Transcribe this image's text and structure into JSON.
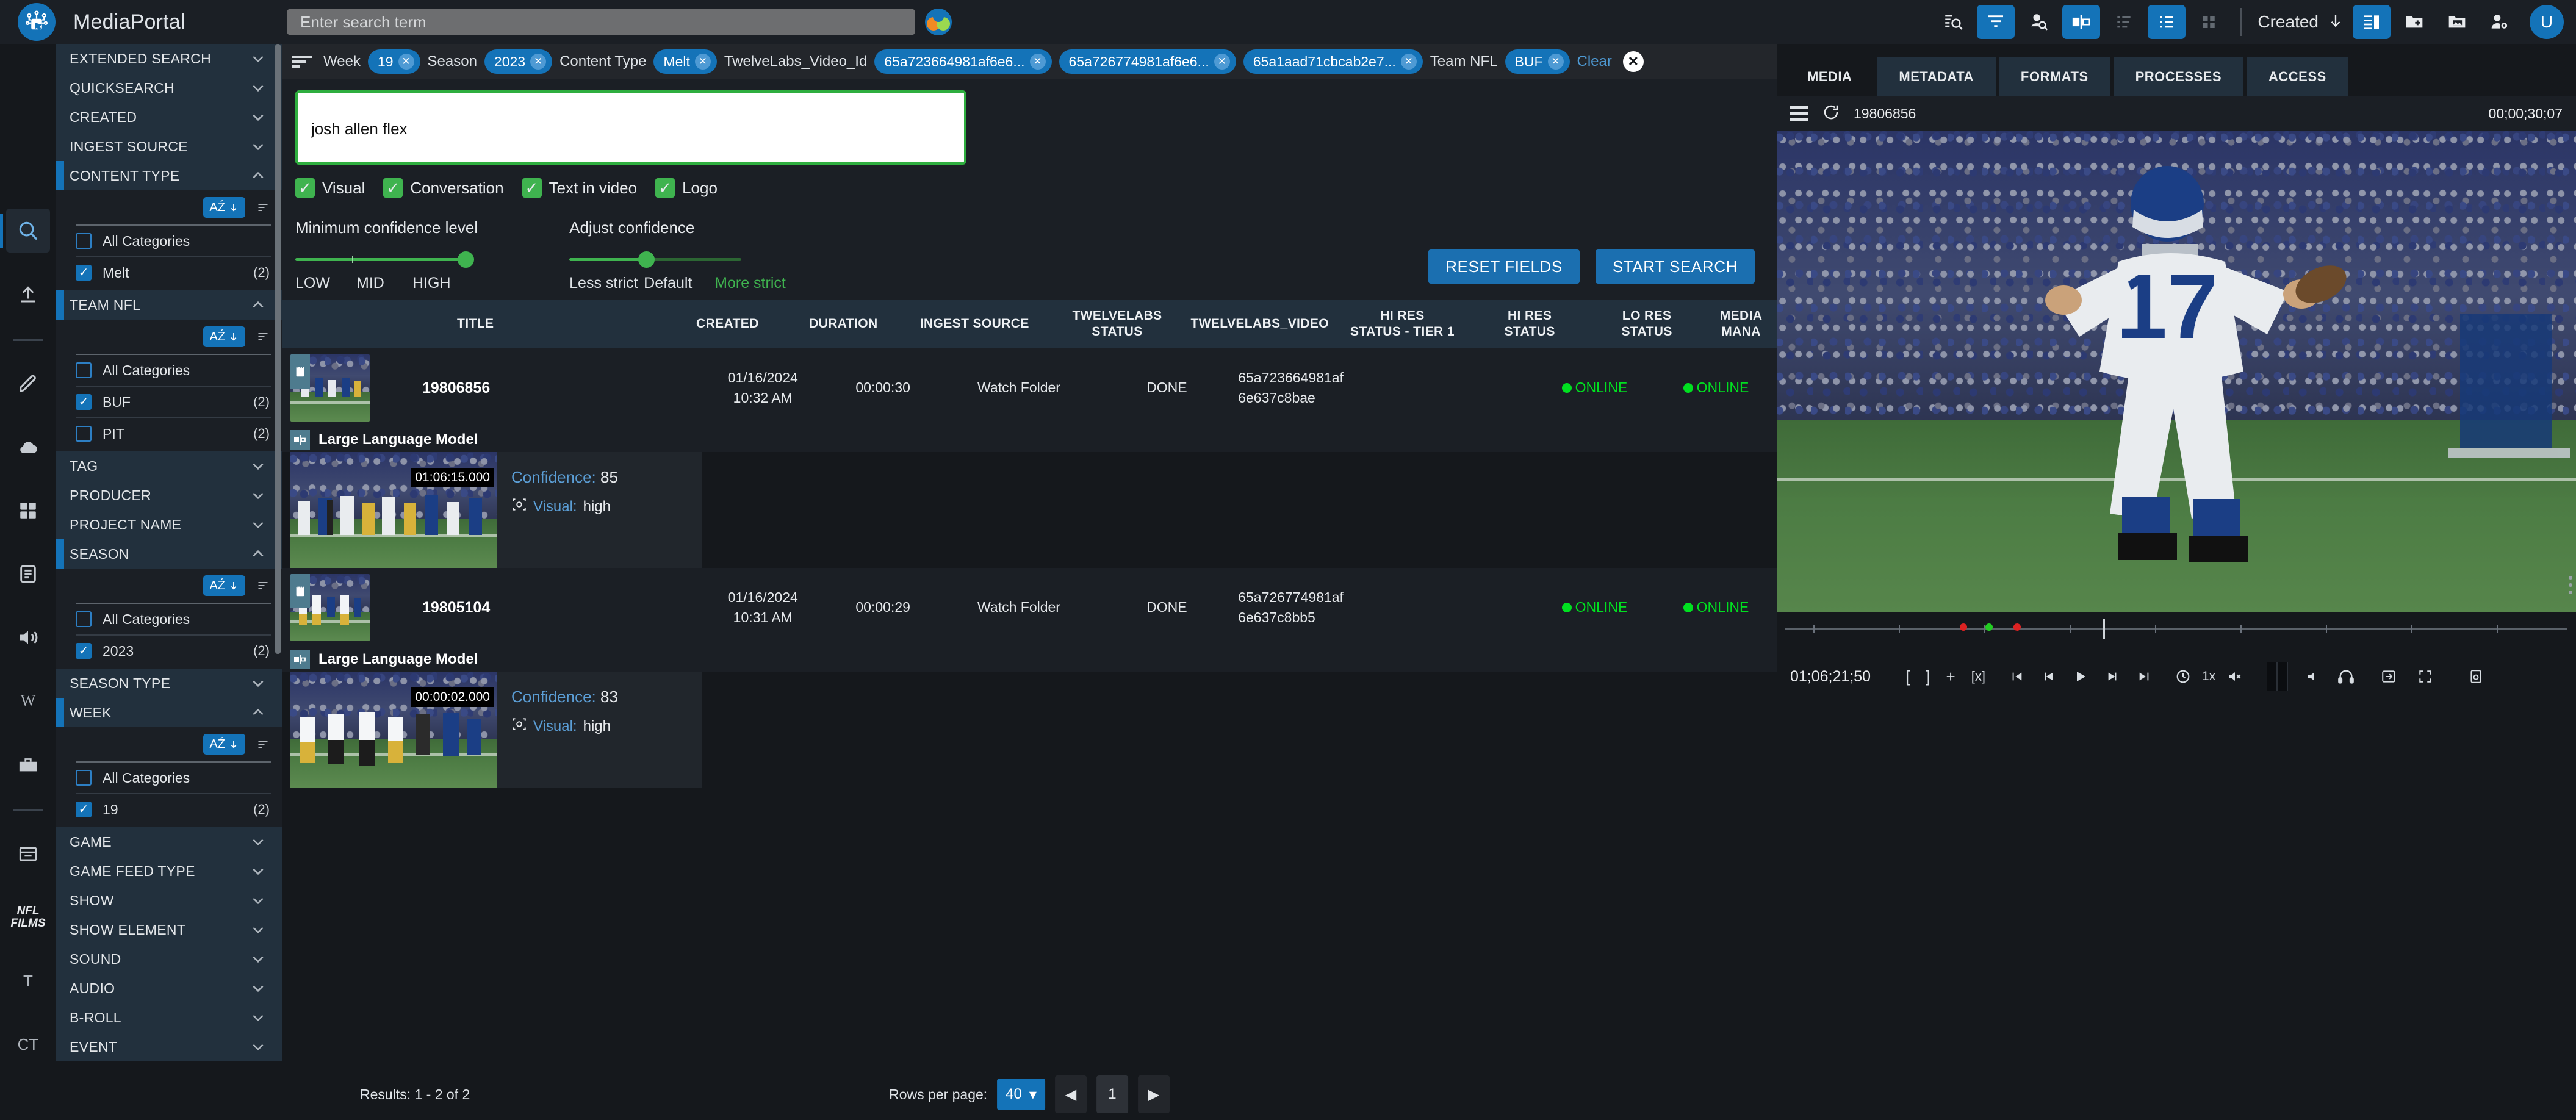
{
  "app": {
    "brand": "MediaPortal",
    "logo_icon": "media-portal-logo-icon",
    "accent_blue": "#1473b8",
    "accent_green": "#3fb34f",
    "status_green": "#00e020"
  },
  "topbar": {
    "search_placeholder": "Enter search term",
    "sort_label": "Created",
    "avatar_initial": "U",
    "icons": [
      {
        "name": "extended-search-icon",
        "active": false
      },
      {
        "name": "filter-icon",
        "active": true
      },
      {
        "name": "person-search-icon",
        "active": false
      },
      {
        "name": "split-view-icon",
        "active": true
      },
      {
        "name": "list-compact-icon",
        "active": false
      },
      {
        "name": "list-detail-icon",
        "active": true
      },
      {
        "name": "grid-view-icon",
        "active": false
      },
      {
        "name": "sort-descending-icon",
        "active": false
      },
      {
        "name": "side-panel-icon",
        "active": true
      },
      {
        "name": "new-folder-icon",
        "active": false
      },
      {
        "name": "media-folder-icon",
        "active": false
      },
      {
        "name": "user-settings-icon",
        "active": false
      }
    ]
  },
  "rail": {
    "items": [
      {
        "name": "search-icon",
        "selected": true
      },
      {
        "name": "upload-icon",
        "selected": false
      },
      {
        "name": "divider",
        "selected": false
      },
      {
        "name": "edit-pen-icon",
        "selected": false
      },
      {
        "name": "cloud-icon",
        "selected": false
      },
      {
        "name": "dashboard-icon",
        "selected": false
      },
      {
        "name": "tasks-icon",
        "selected": false
      },
      {
        "name": "audio-icon",
        "selected": false
      },
      {
        "name": "wikipedia-icon",
        "selected": false
      },
      {
        "name": "toolbox-icon",
        "selected": false
      },
      {
        "name": "divider",
        "selected": false
      },
      {
        "name": "archive-icon",
        "selected": false
      },
      {
        "name": "nfl-films-logo",
        "selected": false
      },
      {
        "name": "t-icon",
        "selected": false
      },
      {
        "name": "ct-icon",
        "selected": false
      }
    ],
    "nfl_line1": "NFL",
    "nfl_line2": "FILMS",
    "t_label": "T",
    "ct_label": "CT"
  },
  "sidebar": {
    "az_label": "Aẋ",
    "all_categories_label": "All Categories",
    "facets": [
      {
        "title": "EXTENDED SEARCH",
        "open": false,
        "options": []
      },
      {
        "title": "QUICKSEARCH",
        "open": false,
        "options": []
      },
      {
        "title": "CREATED",
        "open": false,
        "options": []
      },
      {
        "title": "INGEST SOURCE",
        "open": false,
        "options": []
      },
      {
        "title": "CONTENT TYPE",
        "open": true,
        "options": [
          {
            "label": "All Categories",
            "checked": false,
            "count": ""
          },
          {
            "label": "Melt",
            "checked": true,
            "count": "(2)"
          }
        ]
      },
      {
        "title": "TEAM NFL",
        "open": true,
        "options": [
          {
            "label": "All Categories",
            "checked": false,
            "count": ""
          },
          {
            "label": "BUF",
            "checked": true,
            "count": "(2)"
          },
          {
            "label": "PIT",
            "checked": false,
            "count": "(2)"
          }
        ]
      },
      {
        "title": "TAG",
        "open": false,
        "options": []
      },
      {
        "title": "PRODUCER",
        "open": false,
        "options": []
      },
      {
        "title": "PROJECT NAME",
        "open": false,
        "options": []
      },
      {
        "title": "SEASON",
        "open": true,
        "options": [
          {
            "label": "All Categories",
            "checked": false,
            "count": ""
          },
          {
            "label": "2023",
            "checked": true,
            "count": "(2)"
          }
        ]
      },
      {
        "title": "SEASON TYPE",
        "open": false,
        "options": []
      },
      {
        "title": "WEEK",
        "open": true,
        "options": [
          {
            "label": "All Categories",
            "checked": false,
            "count": ""
          },
          {
            "label": "19",
            "checked": true,
            "count": "(2)"
          }
        ]
      },
      {
        "title": "GAME",
        "open": false,
        "options": []
      },
      {
        "title": "GAME FEED TYPE",
        "open": false,
        "options": []
      },
      {
        "title": "SHOW",
        "open": false,
        "options": []
      },
      {
        "title": "SHOW ELEMENT",
        "open": false,
        "options": []
      },
      {
        "title": "SOUND",
        "open": false,
        "options": []
      },
      {
        "title": "AUDIO",
        "open": false,
        "options": []
      },
      {
        "title": "B-ROLL",
        "open": false,
        "options": []
      },
      {
        "title": "EVENT",
        "open": false,
        "options": []
      }
    ]
  },
  "filterbar": {
    "clear_label": "Clear",
    "groups": [
      {
        "label": "Week",
        "chips": [
          "19"
        ]
      },
      {
        "label": "Season",
        "chips": [
          "2023"
        ]
      },
      {
        "label": "Content Type",
        "chips": [
          "Melt"
        ]
      },
      {
        "label": "TwelveLabs_Video_Id",
        "chips": [
          "65a723664981af6e6...",
          "65a726774981af6e6...",
          "65a1aad71cbcab2e7..."
        ]
      },
      {
        "label": "Team NFL",
        "chips": [
          "BUF"
        ]
      }
    ]
  },
  "searchpanel": {
    "query": "josh allen flex",
    "modalities": [
      {
        "label": "Visual",
        "checked": true
      },
      {
        "label": "Conversation",
        "checked": true
      },
      {
        "label": "Text in video",
        "checked": true
      },
      {
        "label": "Logo",
        "checked": true
      }
    ],
    "min_conf_title": "Minimum confidence level",
    "min_conf_ticks": [
      "LOW",
      "MID",
      "HIGH"
    ],
    "min_conf_value": "HIGH",
    "adjust_conf_title": "Adjust confidence",
    "adjust_conf_ticks": [
      "Less strict",
      "Default",
      "More strict"
    ],
    "adjust_conf_value": "Default",
    "reset_button": "RESET FIELDS",
    "start_button": "START SEARCH"
  },
  "table": {
    "columns": [
      "TITLE",
      "CREATED",
      "DURATION",
      "INGEST SOURCE",
      "TWELVELABS STATUS",
      "TWELVELABS_VIDEO",
      "HI RES STATUS - TIER 1",
      "HI RES STATUS",
      "LO RES STATUS",
      "MEDIA MANA"
    ],
    "rows": [
      {
        "title": "19806856",
        "created_date": "01/16/2024",
        "created_time": "10:32 AM",
        "duration": "00:00:30",
        "ingest_source": "Watch Folder",
        "twelvelabs_status": "DONE",
        "twelvelabs_video_l1": "65a723664981af",
        "twelvelabs_video_l2": "6e637c8bae",
        "hires_tier1": "",
        "hires_status": "ONLINE",
        "lores_status": "ONLINE",
        "llm": {
          "header": "Large Language Model",
          "timecode": "01:06:15.000",
          "confidence_label": "Confidence:",
          "confidence_value": "85",
          "visual_label": "Visual:",
          "visual_value": "high"
        }
      },
      {
        "title": "19805104",
        "created_date": "01/16/2024",
        "created_time": "10:31 AM",
        "duration": "00:00:29",
        "ingest_source": "Watch Folder",
        "twelvelabs_status": "DONE",
        "twelvelabs_video_l1": "65a726774981af",
        "twelvelabs_video_l2": "6e637c8bb5",
        "hires_tier1": "",
        "hires_status": "ONLINE",
        "lores_status": "ONLINE",
        "llm": {
          "header": "Large Language Model",
          "timecode": "00:00:02.000",
          "confidence_label": "Confidence:",
          "confidence_value": "83",
          "visual_label": "Visual:",
          "visual_value": "high"
        }
      }
    ]
  },
  "footer": {
    "results_text": "Results: 1 - 2 of 2",
    "rows_per_page_label": "Rows per page:",
    "rows_per_page_value": "40",
    "current_page": "1"
  },
  "rightpanel": {
    "tabs": [
      {
        "label": "MEDIA",
        "active": true
      },
      {
        "label": "METADATA",
        "active": false
      },
      {
        "label": "FORMATS",
        "active": false
      },
      {
        "label": "PROCESSES",
        "active": false
      },
      {
        "label": "ACCESS",
        "active": false
      }
    ],
    "asset_id": "19806856",
    "total_duration": "00;00;30;07",
    "current_timecode": "01;06;21;50",
    "speed_label": "1x",
    "transport_icons": [
      "mark-in-icon",
      "mark-out-icon",
      "add-marker-icon",
      "clear-marker-icon",
      "go-to-start-icon",
      "step-back-icon",
      "play-icon",
      "step-forward-icon",
      "go-to-end-icon",
      "loop-icon",
      "mute-icon",
      "volume-icon",
      "headphones-icon",
      "export-icon",
      "fullscreen-icon",
      "snapshot-icon"
    ]
  }
}
